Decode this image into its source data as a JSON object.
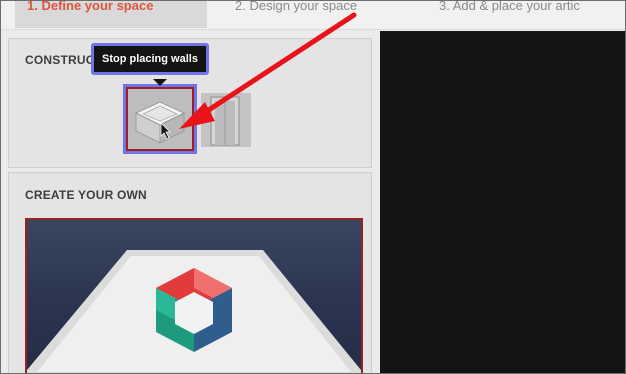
{
  "steps": [
    {
      "label": "1. Define your space",
      "active": true
    },
    {
      "label": "2. Design your space",
      "active": false
    },
    {
      "label": "3. Add & place your artic",
      "active": false
    }
  ],
  "construct": {
    "title": "CONSTRUCT",
    "tooltip": "Stop placing walls",
    "tools": [
      {
        "icon": "wall-box-icon",
        "selected": true
      },
      {
        "icon": "door-icon",
        "selected": false
      }
    ]
  },
  "create": {
    "title": "CREATE YOUR OWN",
    "image_icon": "cube-logo-icon"
  },
  "colors": {
    "accent_red": "#9a2022",
    "active_step": "#e0553f",
    "highlight_blue": "#6f74e8",
    "annotation_arrow": "#e8141a",
    "canvas": "#141414"
  }
}
